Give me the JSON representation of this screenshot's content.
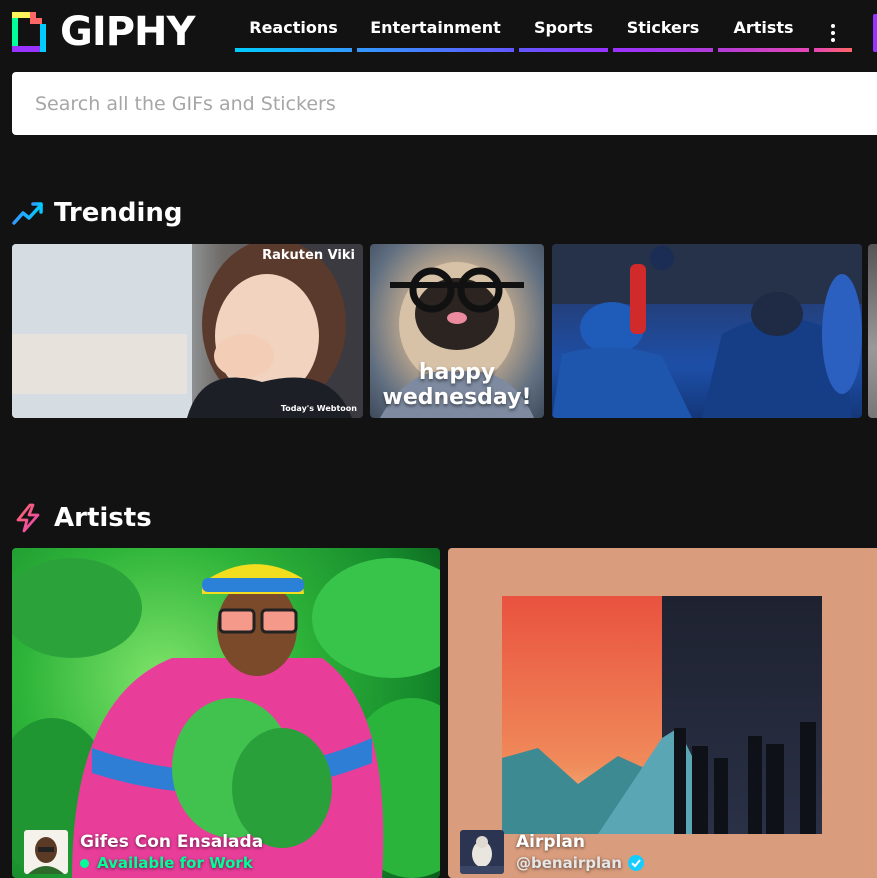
{
  "brand": {
    "name": "GIPHY"
  },
  "nav": {
    "items": [
      {
        "label": "Reactions",
        "color": "#00ccff"
      },
      {
        "label": "Entertainment",
        "color": "#3399ff"
      },
      {
        "label": "Sports",
        "color": "#6157ff"
      },
      {
        "label": "Stickers",
        "color": "#9933ff"
      },
      {
        "label": "Artists",
        "color": "#e646b6"
      }
    ],
    "more_icon": "more-vertical-icon",
    "more_color": "#ff6666"
  },
  "search": {
    "placeholder": "Search all the GIFs and Stickers",
    "value": ""
  },
  "trending": {
    "title": "Trending",
    "icon": "trending-up-icon",
    "tiles": [
      {
        "watermark": "Rakuten Viki",
        "credit": "Today's Webtoon"
      },
      {
        "caption_line1": "happy",
        "caption_line2": "wednesday!"
      },
      {},
      {}
    ]
  },
  "artists": {
    "title": "Artists",
    "icon": "lightning-icon",
    "cards": [
      {
        "name": "Gifes Con Ensalada",
        "status": "Available for Work",
        "status_color": "#00ff99"
      },
      {
        "name": "Airplan",
        "handle": "@benairplan",
        "verified": true
      }
    ]
  }
}
